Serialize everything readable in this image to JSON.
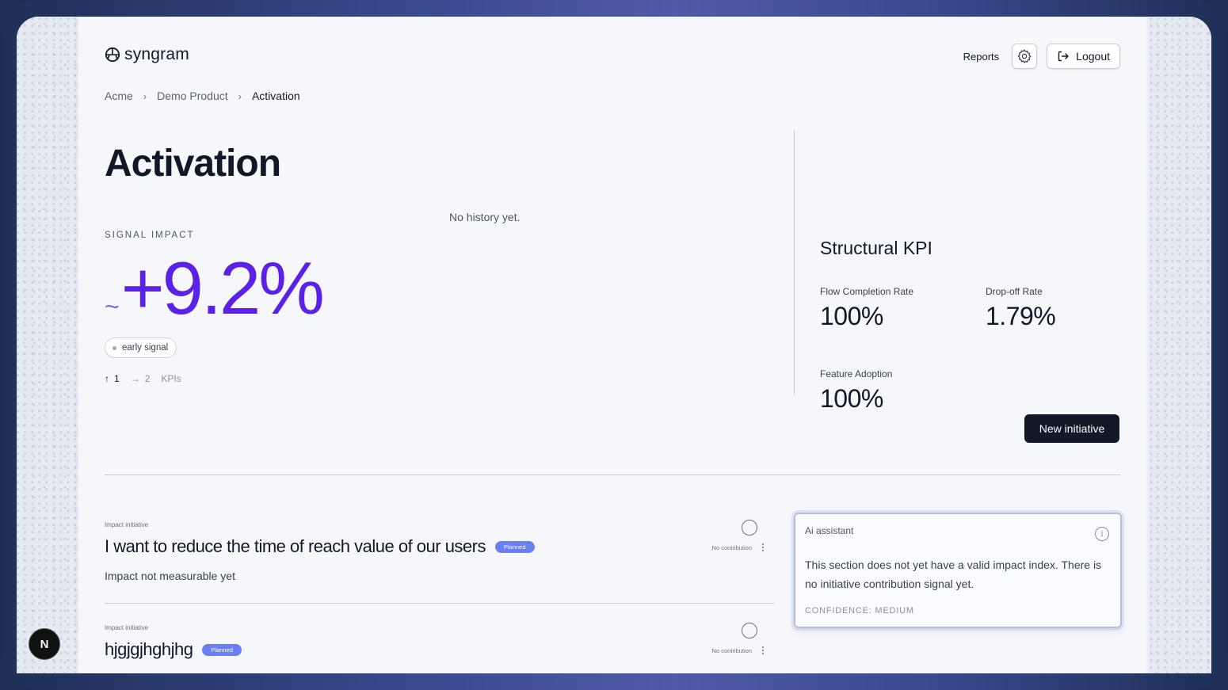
{
  "app": {
    "name": "syngram"
  },
  "header": {
    "reports_label": "Reports",
    "logout_label": "Logout"
  },
  "breadcrumb": [
    {
      "label": "Acme"
    },
    {
      "label": "Demo Product"
    },
    {
      "label": "Activation"
    }
  ],
  "page": {
    "title": "Activation"
  },
  "signal": {
    "label": "SIGNAL IMPACT",
    "tilde": "~",
    "value": "+9.2%",
    "status": "early signal",
    "kpis_up": "1",
    "kpis_flat": "2",
    "kpis_unit": "KPIs"
  },
  "history": {
    "empty_text": "No history yet."
  },
  "structural_kpi": {
    "title": "Structural KPI",
    "items": [
      {
        "label": "Flow Completion Rate",
        "value": "100%"
      },
      {
        "label": "Drop-off Rate",
        "value": "1.79%"
      },
      {
        "label": "Feature Adoption",
        "value": "100%"
      }
    ]
  },
  "actions": {
    "new_initiative": "New initiative"
  },
  "initiatives": [
    {
      "kind": "Impact initiative",
      "title": "I want to reduce the time of reach value of our users",
      "status": "Planned",
      "subtitle": "Impact not measurable yet",
      "contribution": "No contribution"
    },
    {
      "kind": "Impact initiative",
      "title": "hjgjgjhghjhg",
      "status": "Planned",
      "subtitle": "",
      "contribution": "No contribution"
    }
  ],
  "ai_assistant": {
    "label": "Ai assistant",
    "message": "This section does not yet have a valid impact index. There is no initiative contribution signal yet.",
    "confidence": "CONFIDENCE: MEDIUM"
  },
  "dev_badge": {
    "letter": "N"
  },
  "colors": {
    "accent": "#5b21e6",
    "badge": "#6b7ff2",
    "dark_button": "#111827"
  }
}
